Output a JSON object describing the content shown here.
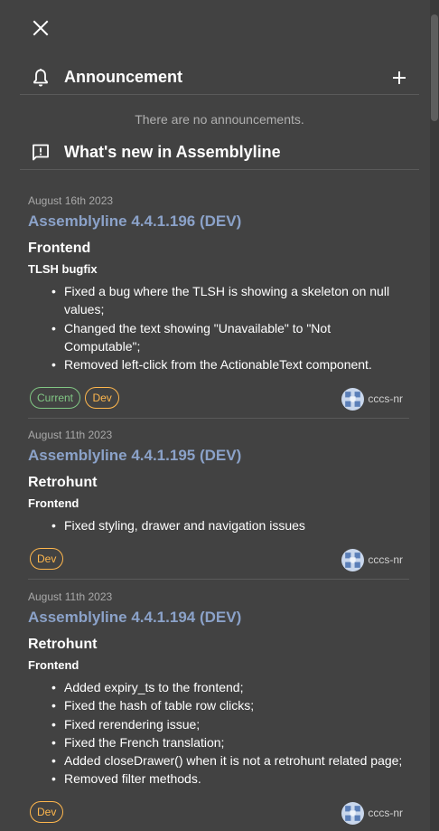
{
  "announcement": {
    "title": "Announcement",
    "empty_message": "There are no announcements."
  },
  "whats_new": {
    "title": "What's new in Assemblyline"
  },
  "releases": [
    {
      "date": "August 16th 2023",
      "title": "Assemblyline 4.4.1.196 (DEV)",
      "section": "Frontend",
      "subsection": "TLSH bugfix",
      "items": [
        "Fixed a bug where the TLSH is showing a skeleton on null values;",
        "Changed the text showing \"Unavailable\" to \"Not Computable\";",
        "Removed left-click from the ActionableText component."
      ],
      "tags": [
        "Current",
        "Dev"
      ],
      "author": "cccs-nr"
    },
    {
      "date": "August 11th 2023",
      "title": "Assemblyline 4.4.1.195 (DEV)",
      "section": "Retrohunt",
      "subsection": "Frontend",
      "items": [
        "Fixed styling, drawer and navigation issues"
      ],
      "tags": [
        "Dev"
      ],
      "author": "cccs-nr"
    },
    {
      "date": "August 11th 2023",
      "title": "Assemblyline 4.4.1.194 (DEV)",
      "section": "Retrohunt",
      "subsection": "Frontend",
      "items": [
        "Added expiry_ts to the frontend;",
        "Fixed the hash of table row clicks;",
        "Fixed rerendering issue;",
        "Fixed the French translation;",
        "Added closeDrawer() when it is not a retrohunt related page;",
        "Removed filter methods."
      ],
      "tags": [
        "Dev"
      ],
      "author": "cccs-nr"
    }
  ],
  "colors": {
    "background": "#424242",
    "release_title": "#8ba2c9",
    "tag_current": "#81c784",
    "tag_dev": "#ffb74d"
  },
  "icons": {
    "close": "close-icon",
    "announcement": "bell-icon",
    "add": "plus-icon",
    "whats_new": "feedback-icon"
  }
}
